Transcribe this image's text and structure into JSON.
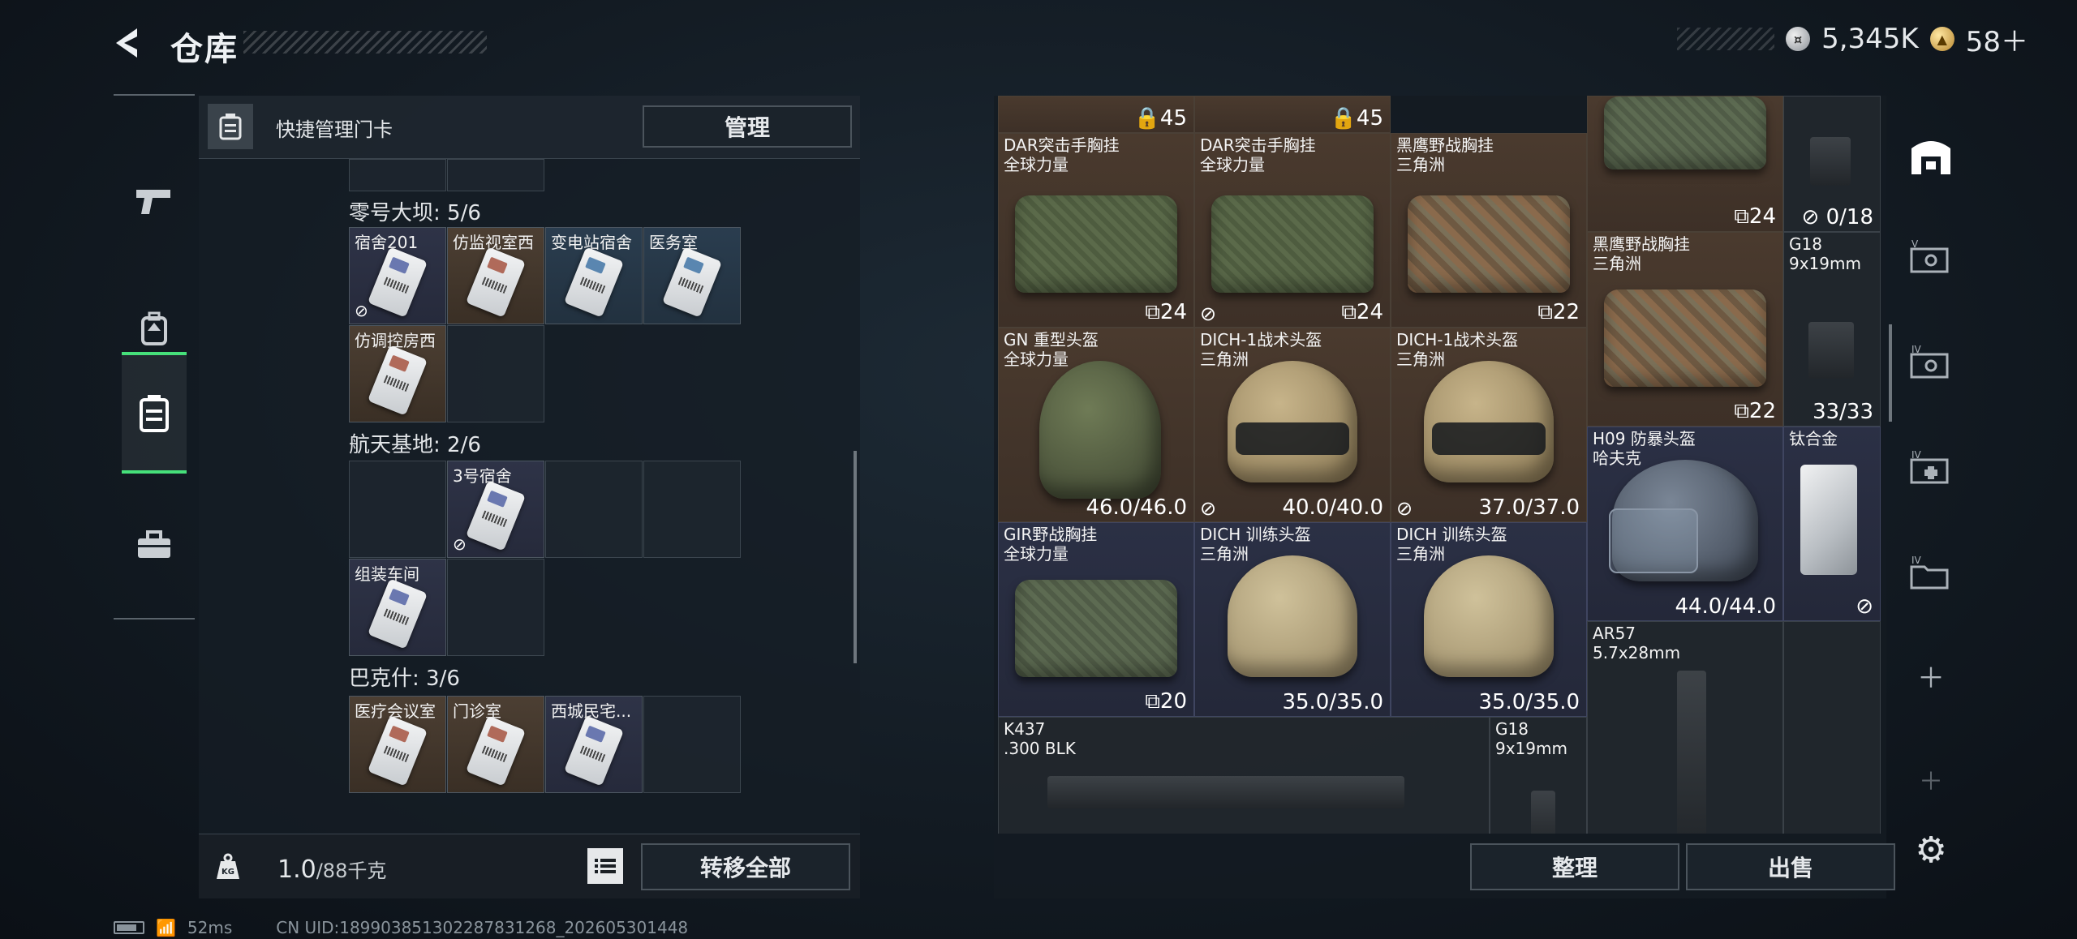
{
  "header": {
    "title": "仓库",
    "currency_silver": "5,345K",
    "currency_gold": "58＋"
  },
  "left_nav": {
    "items": [
      "rifle-icon",
      "backpack-icon",
      "keycard-icon",
      "toolbox-icon"
    ],
    "active_index": 2
  },
  "left_panel": {
    "header_title": "快捷管理门卡",
    "manage_button": "管理",
    "groups": [
      {
        "label": "零号大坝: 5/6",
        "slots": [
          "宿舍201",
          "仿监视室西",
          "变电站宿舍",
          "医务室",
          "仿调控房西"
        ]
      },
      {
        "label": "航天基地: 2/6",
        "slots": [
          "3号宿舍",
          "组装车间"
        ]
      },
      {
        "label": "巴克什: 3/6",
        "slots": [
          "医疗会议室",
          "门诊室",
          "西城民宅..."
        ]
      }
    ],
    "weight_current": "1.0",
    "weight_max": "/88千克",
    "transfer_button": "转移全部"
  },
  "right_panel": {
    "items": [
      {
        "name": "",
        "value": "45"
      },
      {
        "name": "",
        "value": "45"
      },
      {
        "name": "DAR突击手胸挂\n全球力量",
        "value": "24"
      },
      {
        "name": "DAR突击手胸挂\n全球力量",
        "value": "24"
      },
      {
        "name": "黑鹰野战胸挂\n三角洲",
        "value": "22"
      },
      {
        "name": "",
        "value": "24"
      },
      {
        "name": "",
        "value": "0/18"
      },
      {
        "name": "黑鹰野战胸挂\n三角洲",
        "value": "22"
      },
      {
        "name": "G18\n9x19mm",
        "value": "33/33"
      },
      {
        "name": "GN 重型头盔\n全球力量",
        "value": "46.0/46.0"
      },
      {
        "name": "DICH-1战术头盔\n三角洲",
        "value": "40.0/40.0"
      },
      {
        "name": "DICH-1战术头盔\n三角洲",
        "value": "37.0/37.0"
      },
      {
        "name": "H09 防暴头盔\n哈夫克",
        "value": "44.0/44.0"
      },
      {
        "name": "钛合金",
        "value": ""
      },
      {
        "name": "GIR野战胸挂\n全球力量",
        "value": "20"
      },
      {
        "name": "DICH 训练头盔\n三角洲",
        "value": "35.0/35.0"
      },
      {
        "name": "DICH 训练头盔\n三角洲",
        "value": "35.0/35.0"
      },
      {
        "name": "AR57\n5.7x28mm",
        "value": ""
      },
      {
        "name": "K437\n.300 BLK",
        "value": ""
      },
      {
        "name": "G18\n9x19mm",
        "value": ""
      }
    ],
    "organize_button": "整理",
    "sell_button": "出售"
  },
  "status": {
    "ping": "52ms",
    "uid": "CN UID:18990385130228783126​8_202605301448"
  }
}
